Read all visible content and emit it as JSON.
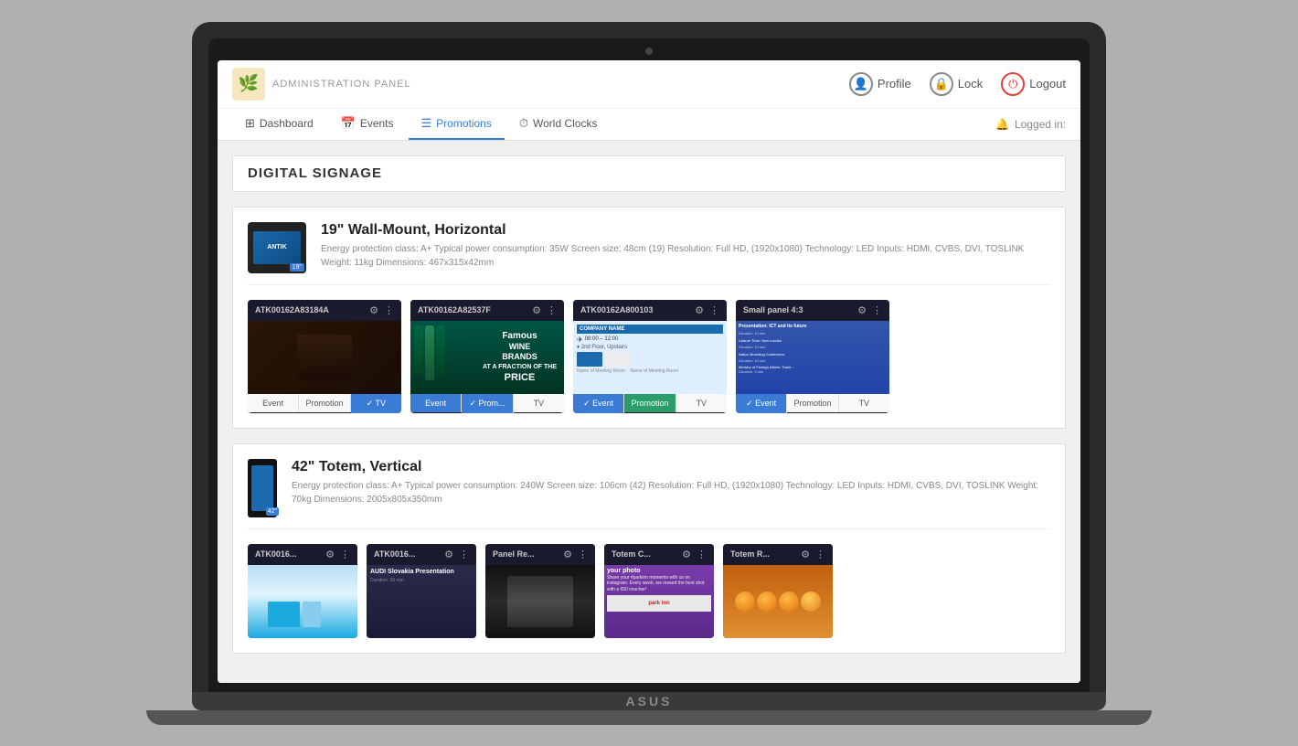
{
  "laptop": {
    "brand": "ASUS"
  },
  "app": {
    "title": "ADMINISTRATION PANEL",
    "logo_icon": "🌿",
    "topbar": {
      "profile_label": "Profile",
      "lock_label": "Lock",
      "logout_label": "Logout",
      "logged_in_label": "Logged in:"
    },
    "navbar": {
      "items": [
        {
          "label": "Dashboard",
          "icon": "⊞",
          "active": false
        },
        {
          "label": "Events",
          "icon": "📅",
          "active": false
        },
        {
          "label": "Promotions",
          "icon": "☰",
          "active": true
        },
        {
          "label": "World Clocks",
          "icon": "⏱",
          "active": false
        }
      ],
      "bell_icon": "🔔"
    },
    "page_title": "DIGITAL SIGNAGE",
    "sections": [
      {
        "id": "wall-mount",
        "device_name": "19\" Wall-Mount, Horizontal",
        "device_size": "19\"",
        "device_specs": "Energy protection class: A+ Typical power consumption: 35W Screen size: 48cm (19) Resolution: Full HD, (1920x1080) Technology: LED Inputs: HDMI, CVBS, DVI, TOSLINK Weight: 11kg Dimensions: 467x315x42mm",
        "panels": [
          {
            "id": "ATK00162A83184A",
            "preview_type": "dark",
            "buttons": [
              {
                "label": "Event",
                "active": false
              },
              {
                "label": "Promotion",
                "active": false
              },
              {
                "label": "✓ TV",
                "active": true
              }
            ]
          },
          {
            "id": "ATK00162A82537F",
            "preview_type": "wine",
            "buttons": [
              {
                "label": "Event",
                "active": true
              },
              {
                "label": "✓ Prom...",
                "active": true
              },
              {
                "label": "TV",
                "active": false
              }
            ]
          },
          {
            "id": "ATK00162A800103",
            "preview_type": "meeting",
            "buttons": [
              {
                "label": "✓ Event",
                "active": true
              },
              {
                "label": "Promotion",
                "active": false
              },
              {
                "label": "TV",
                "active": false
              }
            ]
          },
          {
            "id": "Small panel 4:3",
            "preview_type": "blue",
            "buttons": [
              {
                "label": "✓ Event",
                "active": true
              },
              {
                "label": "Promotion",
                "active": false
              },
              {
                "label": "TV",
                "active": false
              }
            ]
          }
        ]
      },
      {
        "id": "totem",
        "device_name": "42\" Totem, Vertical",
        "device_size": "42\"",
        "device_specs": "Energy protection class: A+ Typical power consumption: 240W Screen size: 106cm (42) Resolution: Full HD, (1920x1080) Technology: LED Inputs: HDMI, CVBS, DVI, TOSLINK Weight: 70kg Dimensions: 2005x805x350mm",
        "panels": [
          {
            "id": "ATK0016...",
            "preview_type": "light-blue",
            "buttons": []
          },
          {
            "id": "ATK0016...",
            "preview_type": "dark-pres",
            "buttons": []
          },
          {
            "id": "Panel Re...",
            "preview_type": "corridor",
            "buttons": []
          },
          {
            "id": "Totem C...",
            "preview_type": "hotel",
            "buttons": []
          },
          {
            "id": "Totem R...",
            "preview_type": "orange",
            "buttons": []
          }
        ]
      }
    ]
  }
}
